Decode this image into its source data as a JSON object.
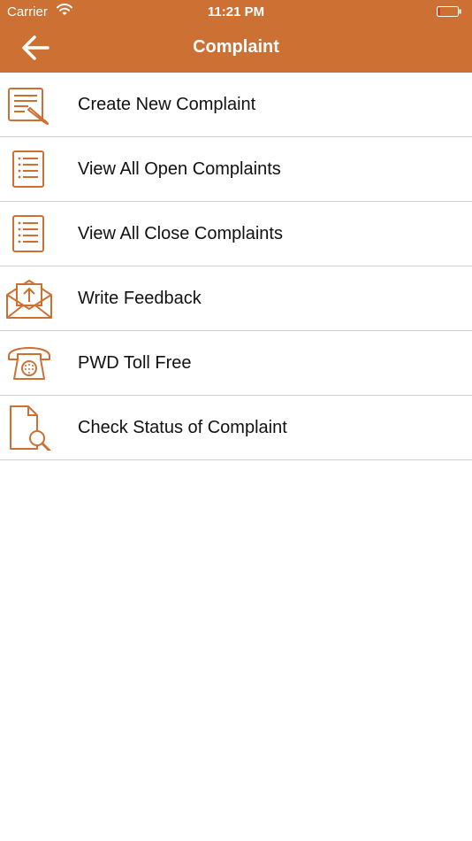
{
  "status_bar": {
    "carrier": "Carrier",
    "time": "11:21 PM",
    "battery_level": 0.05,
    "battery_color": "#e02020"
  },
  "nav": {
    "title": "Complaint",
    "back_icon": "arrow-left-icon"
  },
  "colors": {
    "accent": "#cd7033",
    "text": "#111111",
    "divider": "#d0d0d0"
  },
  "menu": {
    "items": [
      {
        "label": "Create New Complaint",
        "icon": "edit-document-icon"
      },
      {
        "label": "View All Open Complaints",
        "icon": "list-document-icon"
      },
      {
        "label": "View All Close Complaints",
        "icon": "list-document-icon"
      },
      {
        "label": "Write Feedback",
        "icon": "envelope-upload-icon"
      },
      {
        "label": "PWD Toll Free",
        "icon": "telephone-icon"
      },
      {
        "label": "Check Status of Complaint",
        "icon": "document-search-icon"
      }
    ]
  }
}
